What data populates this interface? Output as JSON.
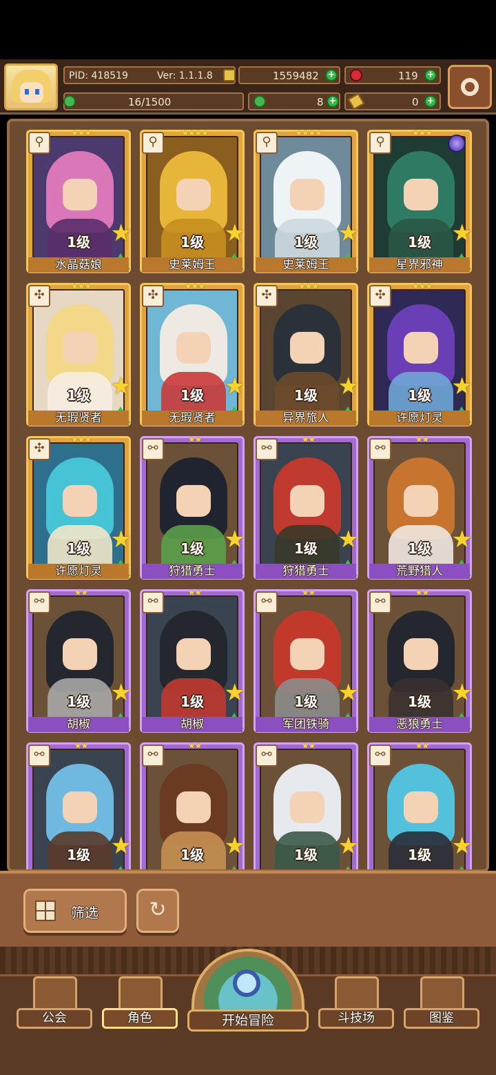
{
  "header": {
    "pid": "PID: 418519",
    "version": "Ver: 1.1.1.8",
    "coins": "1559482",
    "gems": "119",
    "roster": "16/1500",
    "clovers": "8",
    "tickets": "0"
  },
  "roster": [
    {
      "level": "1级",
      "name": "水晶菇娘",
      "stars": "★★★",
      "rarity": "gold",
      "badge": "⚲",
      "hair": "#d977b8",
      "body": "#5a2f6a",
      "bg": "#4a3a6e"
    },
    {
      "level": "1级",
      "name": "史莱姆王",
      "stars": "★★★★",
      "rarity": "gold",
      "badge": "⚲",
      "hair": "#e7b53a",
      "body": "#c58f20",
      "bg": "#8a5e1e"
    },
    {
      "level": "1级",
      "name": "史莱姆王",
      "stars": "★★★★",
      "rarity": "gold",
      "badge": "⚲",
      "hair": "#eef3f5",
      "body": "#cdd9de",
      "bg": "#6f8a9a"
    },
    {
      "level": "1级",
      "name": "星界邪神",
      "stars": "★★★",
      "rarity": "gold",
      "badge": "⚲",
      "hair": "#2f7a62",
      "body": "#2a5646",
      "bg": "#1e3c34",
      "orb": true
    },
    {
      "level": "1级",
      "name": "无瑕贤者",
      "stars": "★★★",
      "rarity": "gold",
      "badge": "✣",
      "hair": "#f3d889",
      "body": "#f6eee2",
      "bg": "#e6d8c2"
    },
    {
      "level": "1级",
      "name": "无瑕贤者",
      "stars": "★★★",
      "rarity": "gold",
      "badge": "✣",
      "hair": "#eeeae3",
      "body": "#c93a3a",
      "bg": "#6fb7d4"
    },
    {
      "level": "1级",
      "name": "异界旅人",
      "stars": "★★★",
      "rarity": "gold",
      "badge": "✣",
      "hair": "#2b3138",
      "body": "#6b4a2a",
      "bg": "#5a4530"
    },
    {
      "level": "1级",
      "name": "许愿灯灵",
      "stars": "★★★",
      "rarity": "gold",
      "badge": "✣",
      "hair": "#6a3fb5",
      "body": "#6fa6d6",
      "bg": "#2e2a55"
    },
    {
      "level": "1级",
      "name": "许愿灯灵",
      "stars": "★★★",
      "rarity": "gold",
      "badge": "✣",
      "hair": "#46c4d6",
      "body": "#f1e6c8",
      "bg": "#2f6f8e"
    },
    {
      "level": "1级",
      "name": "狩猎勇士",
      "stars": "★★",
      "rarity": "purple",
      "badge": "⚯",
      "hair": "#1f2430",
      "body": "#5aa04a",
      "bg": "#6a5138"
    },
    {
      "level": "1级",
      "name": "狩猎勇士",
      "stars": "★★",
      "rarity": "purple",
      "badge": "⚯",
      "hair": "#c13a30",
      "body": "#3a3a2a",
      "bg": "#3a4450"
    },
    {
      "level": "1级",
      "name": "荒野猎人",
      "stars": "★★",
      "rarity": "purple",
      "badge": "⚯",
      "hair": "#c7752e",
      "body": "#eee8e0",
      "bg": "#6a5138"
    },
    {
      "level": "1级",
      "name": "胡椒",
      "stars": "★★",
      "rarity": "purple",
      "badge": "⚯",
      "hair": "#24272e",
      "body": "#a7a7a7",
      "bg": "#6a5138"
    },
    {
      "level": "1级",
      "name": "胡椒",
      "stars": "★★",
      "rarity": "purple",
      "badge": "⚯",
      "hair": "#24272e",
      "body": "#c13a30",
      "bg": "#3a4450"
    },
    {
      "level": "1级",
      "name": "军团铁骑",
      "stars": "★★",
      "rarity": "purple",
      "badge": "⚯",
      "hair": "#c1392b",
      "body": "#8c8c8c",
      "bg": "#6a5138"
    },
    {
      "level": "1级",
      "name": "恶狼勇士",
      "stars": "★★",
      "rarity": "purple",
      "badge": "⚯",
      "hair": "#25272f",
      "body": "#3a3130",
      "bg": "#6a5138"
    },
    {
      "level": "1级",
      "name": "",
      "stars": "★★",
      "rarity": "purple",
      "badge": "⚯",
      "hair": "#6fb8e0",
      "body": "#5a3b2a",
      "bg": "#3a4450"
    },
    {
      "level": "1级",
      "name": "",
      "stars": "★★",
      "rarity": "purple",
      "badge": "⚯",
      "hair": "#6a3a22",
      "body": "#c58f52",
      "bg": "#6a5138"
    },
    {
      "level": "1级",
      "name": "",
      "stars": "★★",
      "rarity": "purple",
      "badge": "⚯",
      "hair": "#e6e9ee",
      "body": "#3a5a4a",
      "bg": "#6a5138"
    },
    {
      "level": "1级",
      "name": "",
      "stars": "★★",
      "rarity": "purple",
      "badge": "⚯",
      "hair": "#54c1dc",
      "body": "#2a2e3a",
      "bg": "#6a5138"
    }
  ],
  "filter": {
    "label": "筛选"
  },
  "nav": {
    "guild": "公会",
    "characters": "角色",
    "start": "开始冒险",
    "arena": "斗技场",
    "codex": "图鉴"
  },
  "colors": {
    "frame": "#6d4b31",
    "gold_card": "#e2a53e",
    "purple_card": "#a36ad1",
    "plus": "#37b64a"
  }
}
